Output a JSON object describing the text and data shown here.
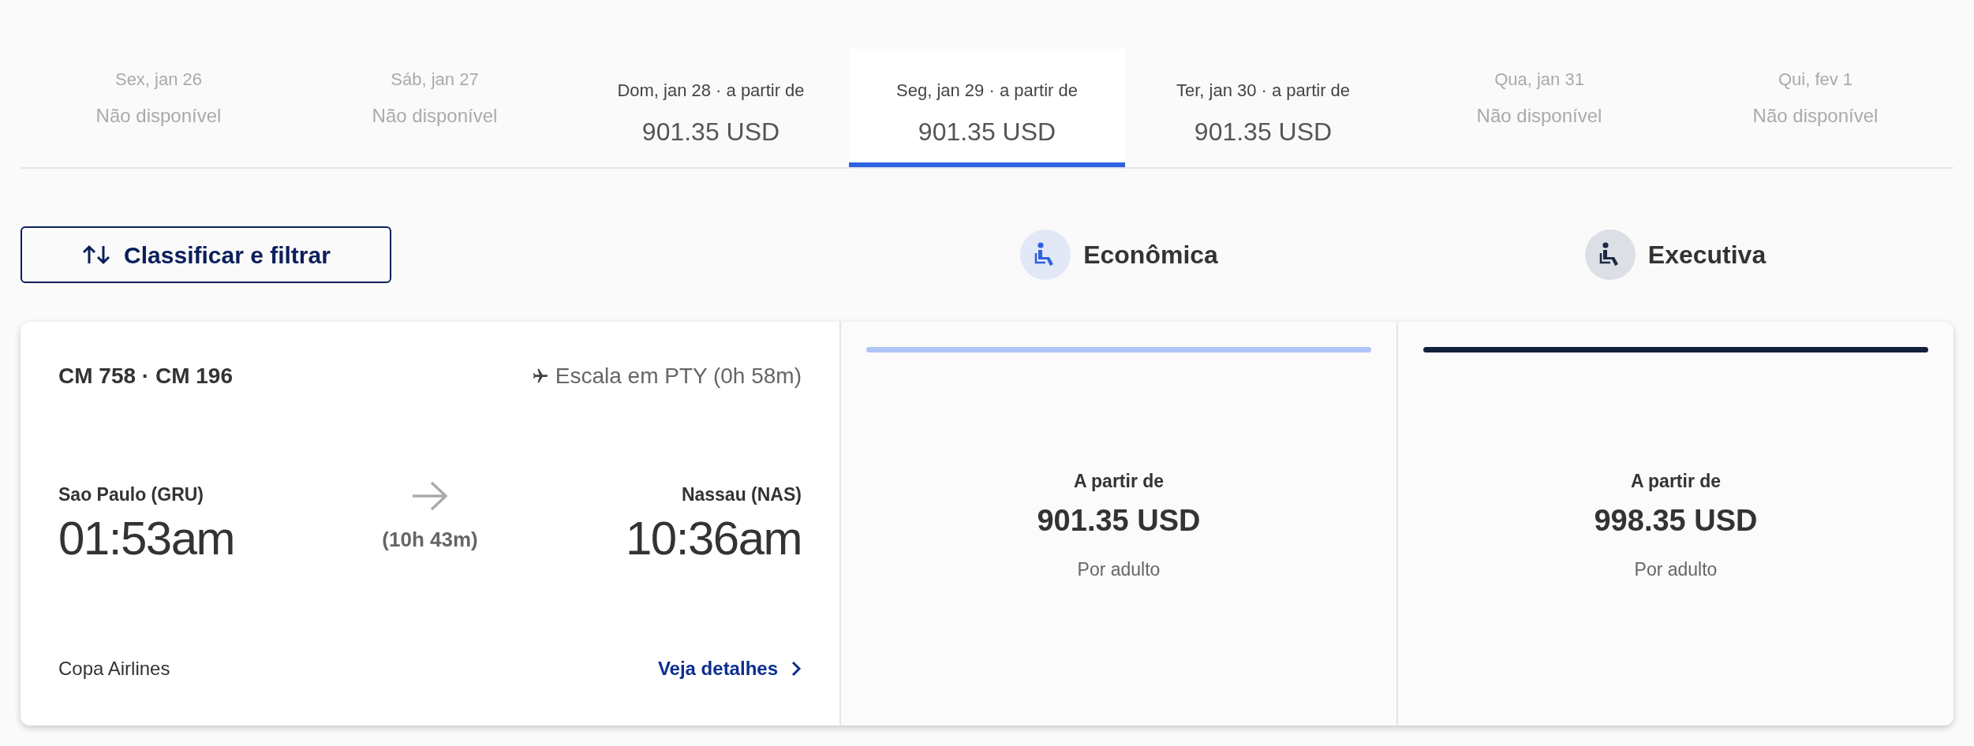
{
  "date_tabs": [
    {
      "kind": "unavailable",
      "date": "Sex, jan 26",
      "status": "Não disponível",
      "selected": false
    },
    {
      "kind": "unavailable",
      "date": "Sáb, jan 27",
      "status": "Não disponível",
      "selected": false
    },
    {
      "kind": "available",
      "date": "Dom, jan 28 · a partir de",
      "price": "901.35 USD",
      "selected": false
    },
    {
      "kind": "available",
      "date": "Seg, jan 29 · a partir de",
      "price": "901.35 USD",
      "selected": true
    },
    {
      "kind": "available",
      "date": "Ter, jan 30 · a partir de",
      "price": "901.35 USD",
      "selected": false
    },
    {
      "kind": "unavailable",
      "date": "Qua, jan 31",
      "status": "Não disponível",
      "selected": false
    },
    {
      "kind": "unavailable",
      "date": "Qui, fev 1",
      "status": "Não disponível",
      "selected": false
    }
  ],
  "sort_filter_button": "Classificar e filtrar",
  "cabins": [
    {
      "label": "Econômica",
      "color": "#2f62e0"
    },
    {
      "label": "Executiva",
      "color": "#1c2a44"
    }
  ],
  "flight": {
    "flight_numbers": "CM 758 · CM 196",
    "stop": "Escala em PTY (0h 58m)",
    "origin": "Sao Paulo (GRU)",
    "departure": "01:53am",
    "duration": "(10h 43m)",
    "destination": "Nassau (NAS)",
    "arrival": "10:36am",
    "airline": "Copa Airlines",
    "details_link": "Veja detalhes"
  },
  "fares": [
    {
      "label": "A partir de",
      "price": "901.35 USD",
      "note": "Por adulto",
      "color": "#aec4f7"
    },
    {
      "label": "A partir de",
      "price": "998.35 USD",
      "note": "Por adulto",
      "color": "#14213d"
    }
  ]
}
